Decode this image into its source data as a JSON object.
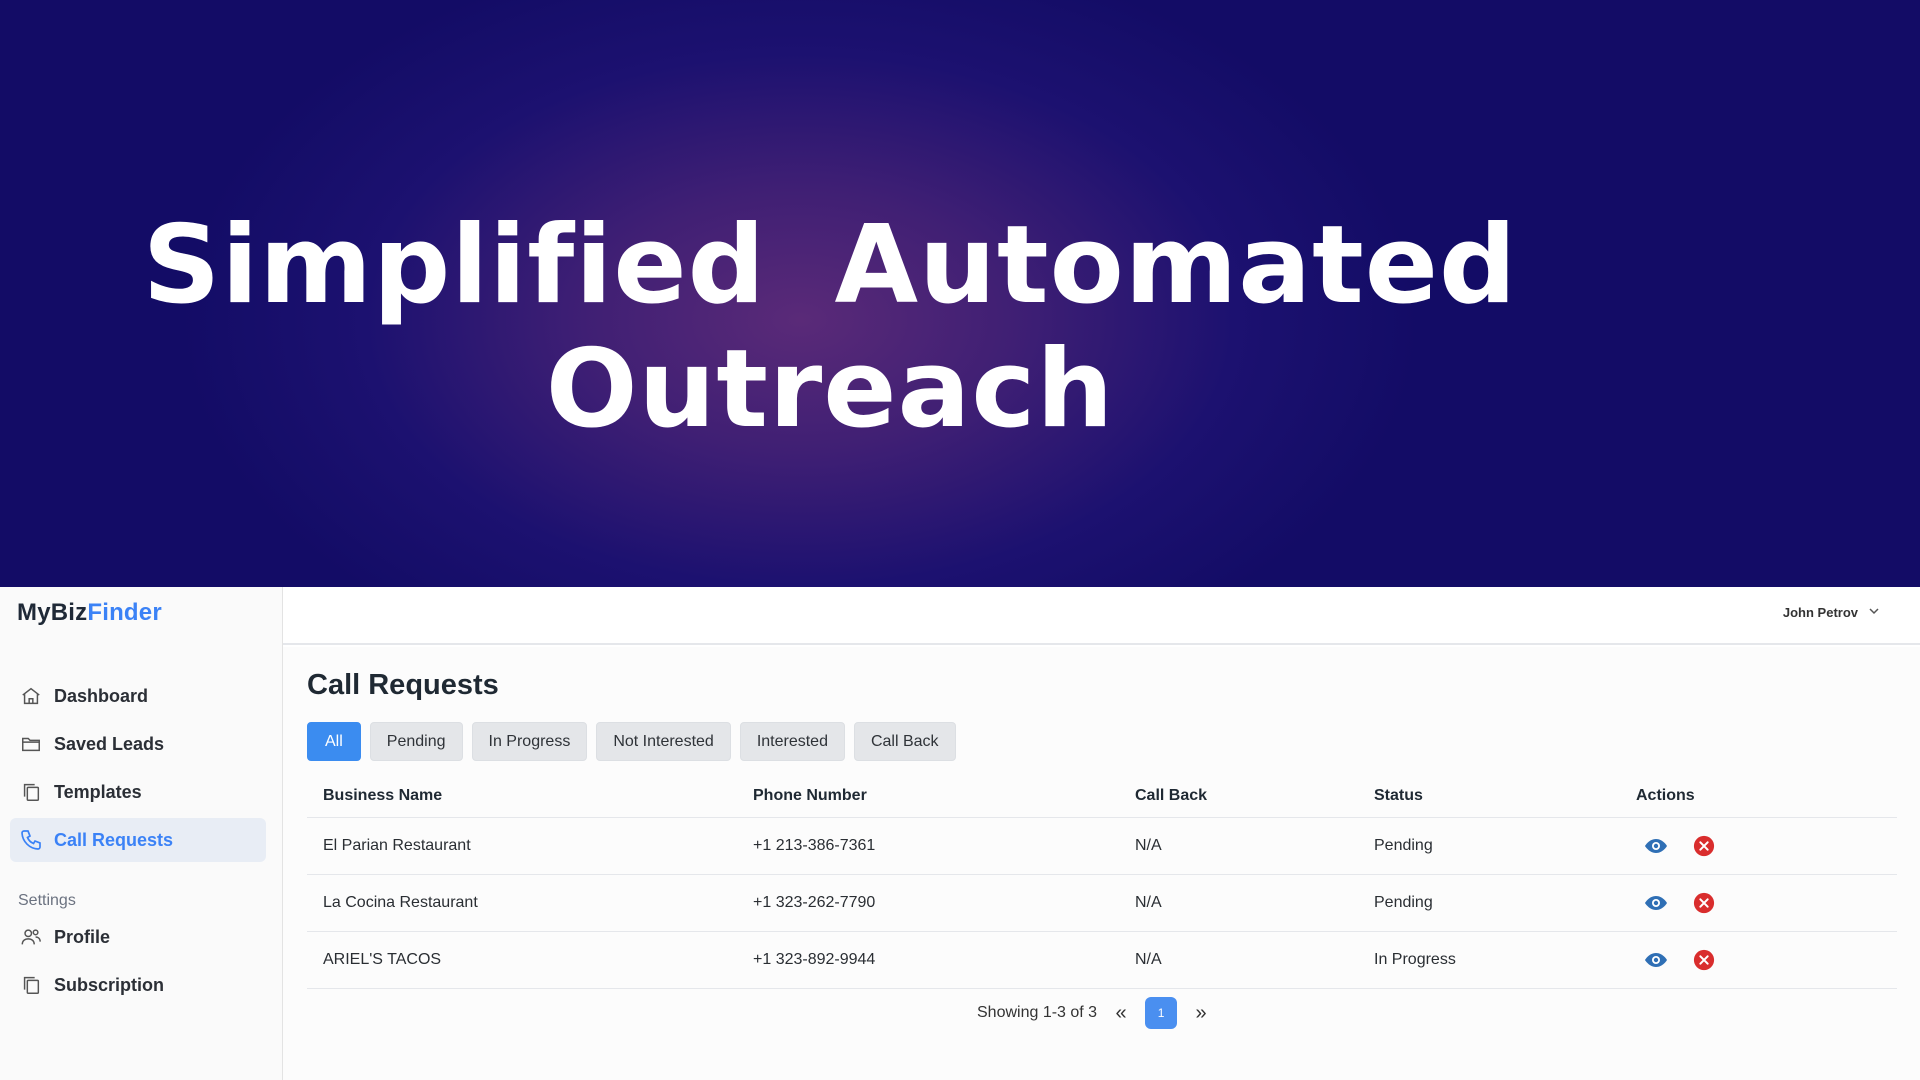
{
  "hero": {
    "line1": "Simplified  Automated",
    "line2": "Outreach"
  },
  "brand": {
    "part1": "MyBiz",
    "part2": "Finder"
  },
  "sidebar": {
    "items": [
      {
        "label": "Dashboard",
        "icon": "home-icon"
      },
      {
        "label": "Saved Leads",
        "icon": "folder-icon"
      },
      {
        "label": "Templates",
        "icon": "copy-icon"
      },
      {
        "label": "Call Requests",
        "icon": "phone-icon",
        "active": true
      }
    ],
    "settings_label": "Settings",
    "settings_items": [
      {
        "label": "Profile",
        "icon": "users-icon"
      },
      {
        "label": "Subscription",
        "icon": "copy-icon"
      }
    ]
  },
  "topbar": {
    "user_name": "John Petrov"
  },
  "main": {
    "title": "Call Requests",
    "filters": [
      "All",
      "Pending",
      "In Progress",
      "Not Interested",
      "Interested",
      "Call Back"
    ],
    "table": {
      "headers": [
        "Business Name",
        "Phone Number",
        "Call Back",
        "Status",
        "Actions"
      ],
      "rows": [
        {
          "business": "El Parian Restaurant",
          "phone": "+1 213-386-7361",
          "callback": "N/A",
          "status": "Pending"
        },
        {
          "business": "La Cocina Restaurant",
          "phone": "+1 323-262-7790",
          "callback": "N/A",
          "status": "Pending"
        },
        {
          "business": "ARIEL'S TACOS",
          "phone": "+1 323-892-9944",
          "callback": "N/A",
          "status": "In Progress"
        }
      ]
    },
    "pagination": {
      "showing": "Showing 1-3 of 3",
      "current_page": "1",
      "prev": "«",
      "next": "»"
    }
  },
  "colors": {
    "accent": "#3b82f6",
    "danger": "#d92d2d",
    "eye": "#2f6fb5"
  }
}
